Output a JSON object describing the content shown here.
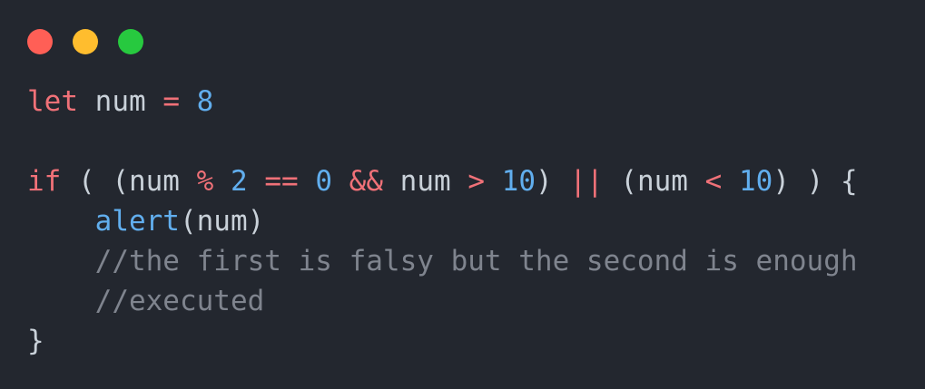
{
  "window": {
    "controls": [
      {
        "name": "close-button",
        "color": "#ff5f56"
      },
      {
        "name": "minimize-button",
        "color": "#ffbd2e"
      },
      {
        "name": "maximize-button",
        "color": "#27c93f"
      }
    ]
  },
  "colors": {
    "background": "#23272f",
    "keyword": "#f07178",
    "operator": "#f07178",
    "number": "#61aeee",
    "function": "#61aeee",
    "identifier": "#c9d1d9",
    "punctuation": "#c9d1d9",
    "comment": "#7f848e"
  },
  "code_lines": [
    [
      {
        "text": "let",
        "type": "keyword"
      },
      {
        "text": " num ",
        "type": "identifier"
      },
      {
        "text": "=",
        "type": "operator"
      },
      {
        "text": " ",
        "type": "identifier"
      },
      {
        "text": "8",
        "type": "number"
      }
    ],
    [],
    [
      {
        "text": "if",
        "type": "keyword"
      },
      {
        "text": " ( (num ",
        "type": "identifier"
      },
      {
        "text": "%",
        "type": "operator"
      },
      {
        "text": " ",
        "type": "identifier"
      },
      {
        "text": "2",
        "type": "number"
      },
      {
        "text": " ",
        "type": "identifier"
      },
      {
        "text": "==",
        "type": "operator"
      },
      {
        "text": " ",
        "type": "identifier"
      },
      {
        "text": "0",
        "type": "number"
      },
      {
        "text": " ",
        "type": "identifier"
      },
      {
        "text": "&&",
        "type": "operator"
      },
      {
        "text": " num ",
        "type": "identifier"
      },
      {
        "text": ">",
        "type": "operator"
      },
      {
        "text": " ",
        "type": "identifier"
      },
      {
        "text": "10",
        "type": "number"
      },
      {
        "text": ") ",
        "type": "identifier"
      },
      {
        "text": "||",
        "type": "operator"
      },
      {
        "text": " (num ",
        "type": "identifier"
      },
      {
        "text": "<",
        "type": "operator"
      },
      {
        "text": " ",
        "type": "identifier"
      },
      {
        "text": "10",
        "type": "number"
      },
      {
        "text": ") ) {",
        "type": "punctuation"
      }
    ],
    [
      {
        "text": "    ",
        "type": "identifier"
      },
      {
        "text": "alert",
        "type": "function"
      },
      {
        "text": "(num)",
        "type": "punctuation"
      }
    ],
    [
      {
        "text": "    ",
        "type": "identifier"
      },
      {
        "text": "//the first is falsy but the second is enough",
        "type": "comment"
      }
    ],
    [
      {
        "text": "    ",
        "type": "identifier"
      },
      {
        "text": "//executed",
        "type": "comment"
      }
    ],
    [
      {
        "text": "}",
        "type": "punctuation"
      }
    ]
  ]
}
